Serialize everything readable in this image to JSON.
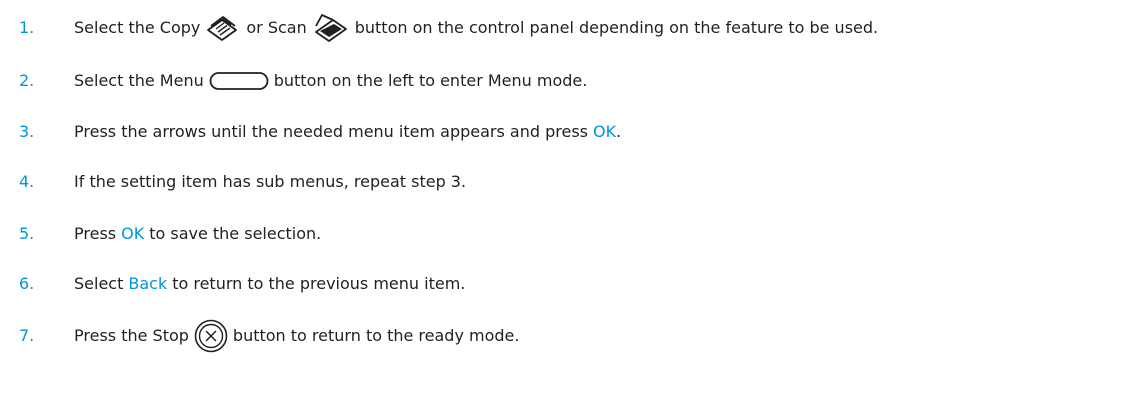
{
  "colors": {
    "step_number": "#0096d6",
    "highlight": "#0096d6",
    "text": "#231f20"
  },
  "steps": [
    {
      "num": "1.",
      "parts": {
        "a": "Select the Copy",
        "b": "or Scan",
        "c": "button on the control panel depending on the feature to be used."
      },
      "icons": [
        "copy-icon",
        "scan-icon"
      ]
    },
    {
      "num": "2.",
      "parts": {
        "a": "Select the Menu",
        "b": "button on the left to enter Menu mode."
      },
      "icons": [
        "menu-button-icon"
      ]
    },
    {
      "num": "3.",
      "parts": {
        "a": "Press the arrows until the needed menu item appears and press",
        "hl": "OK",
        "b": "."
      }
    },
    {
      "num": "4.",
      "parts": {
        "a": "If the setting item has sub menus, repeat step 3."
      }
    },
    {
      "num": "5.",
      "parts": {
        "a": "Press",
        "hl": "OK",
        "b": "to save the selection."
      }
    },
    {
      "num": "6.",
      "parts": {
        "a": "Select",
        "hl": "Back",
        "b": "to return to the previous menu item."
      }
    },
    {
      "num": "7.",
      "parts": {
        "a": "Press the Stop",
        "b": "button to return to the ready mode."
      },
      "icons": [
        "stop-icon"
      ]
    }
  ]
}
